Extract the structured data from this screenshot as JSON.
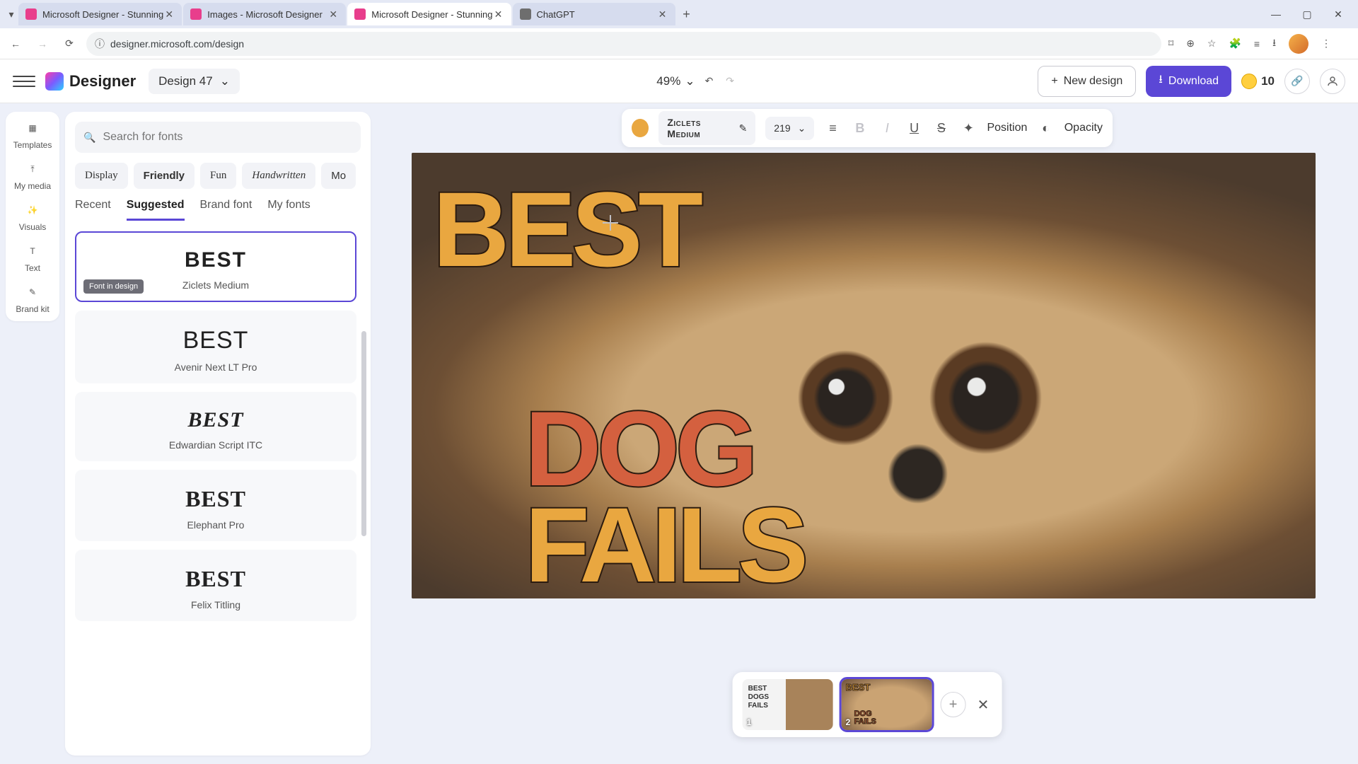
{
  "browser": {
    "tabs": [
      {
        "title": "Microsoft Designer - Stunning",
        "favcolor": "#e83e8c"
      },
      {
        "title": "Images - Microsoft Designer",
        "favcolor": "#e83e8c"
      },
      {
        "title": "Microsoft Designer - Stunning",
        "favcolor": "#e83e8c"
      },
      {
        "title": "ChatGPT",
        "favcolor": "#6e6e6e"
      }
    ],
    "active_tab_index": 2,
    "url": "designer.microsoft.com/design"
  },
  "app": {
    "brand": "Designer",
    "design_name": "Design 47",
    "zoom": "49%",
    "new_design_label": "New design",
    "download_label": "Download",
    "credits": "10"
  },
  "side_rail": {
    "items": [
      {
        "label": "Templates"
      },
      {
        "label": "My media"
      },
      {
        "label": "Visuals"
      },
      {
        "label": "Text"
      },
      {
        "label": "Brand kit"
      }
    ]
  },
  "font_panel": {
    "search_placeholder": "Search for fonts",
    "categories": [
      {
        "label": "Display",
        "style": "font-family:serif;"
      },
      {
        "label": "Friendly",
        "style": "font-weight:600;"
      },
      {
        "label": "Fun",
        "style": "font-family:'Comic Sans MS',cursive;"
      },
      {
        "label": "Handwritten",
        "style": "font-family:cursive;font-style:italic;"
      },
      {
        "label": "Mo",
        "style": ""
      }
    ],
    "tabs": [
      {
        "label": "Recent"
      },
      {
        "label": "Suggested"
      },
      {
        "label": "Brand font"
      },
      {
        "label": "My fonts"
      }
    ],
    "active_tab_index": 1,
    "fonts": [
      {
        "preview": "BEST",
        "name": "Ziclets Medium",
        "badge": "Font in design",
        "selected": true,
        "preview_style": "font-weight:900;letter-spacing:2px;"
      },
      {
        "preview": "BEST",
        "name": "Avenir Next LT Pro",
        "preview_style": "font-weight:300;font-size:34px;"
      },
      {
        "preview": "BEST",
        "name": "Edwardian Script ITC",
        "preview_style": "font-family:cursive;font-style:italic;font-size:30px;"
      },
      {
        "preview": "BEST",
        "name": "Elephant Pro",
        "preview_style": "font-family:Georgia,serif;font-weight:900;font-size:32px;"
      },
      {
        "preview": "BEST",
        "name": "Felix Titling",
        "preview_style": "font-family:'Times New Roman',serif;font-size:32px;letter-spacing:1px;"
      }
    ]
  },
  "context_toolbar": {
    "color": "#e9a740",
    "font_name": "Ziclets Medium",
    "font_size": "219",
    "position_label": "Position",
    "opacity_label": "Opacity"
  },
  "canvas": {
    "words": {
      "best": "BEST",
      "dog": "DOG",
      "fails": "FAILS"
    },
    "colors": {
      "best": "#e9a740",
      "dog": "#d4603f",
      "fails": "#e9a740"
    }
  },
  "pages": {
    "items": [
      {
        "num": "1"
      },
      {
        "num": "2"
      }
    ],
    "selected_index": 1
  }
}
